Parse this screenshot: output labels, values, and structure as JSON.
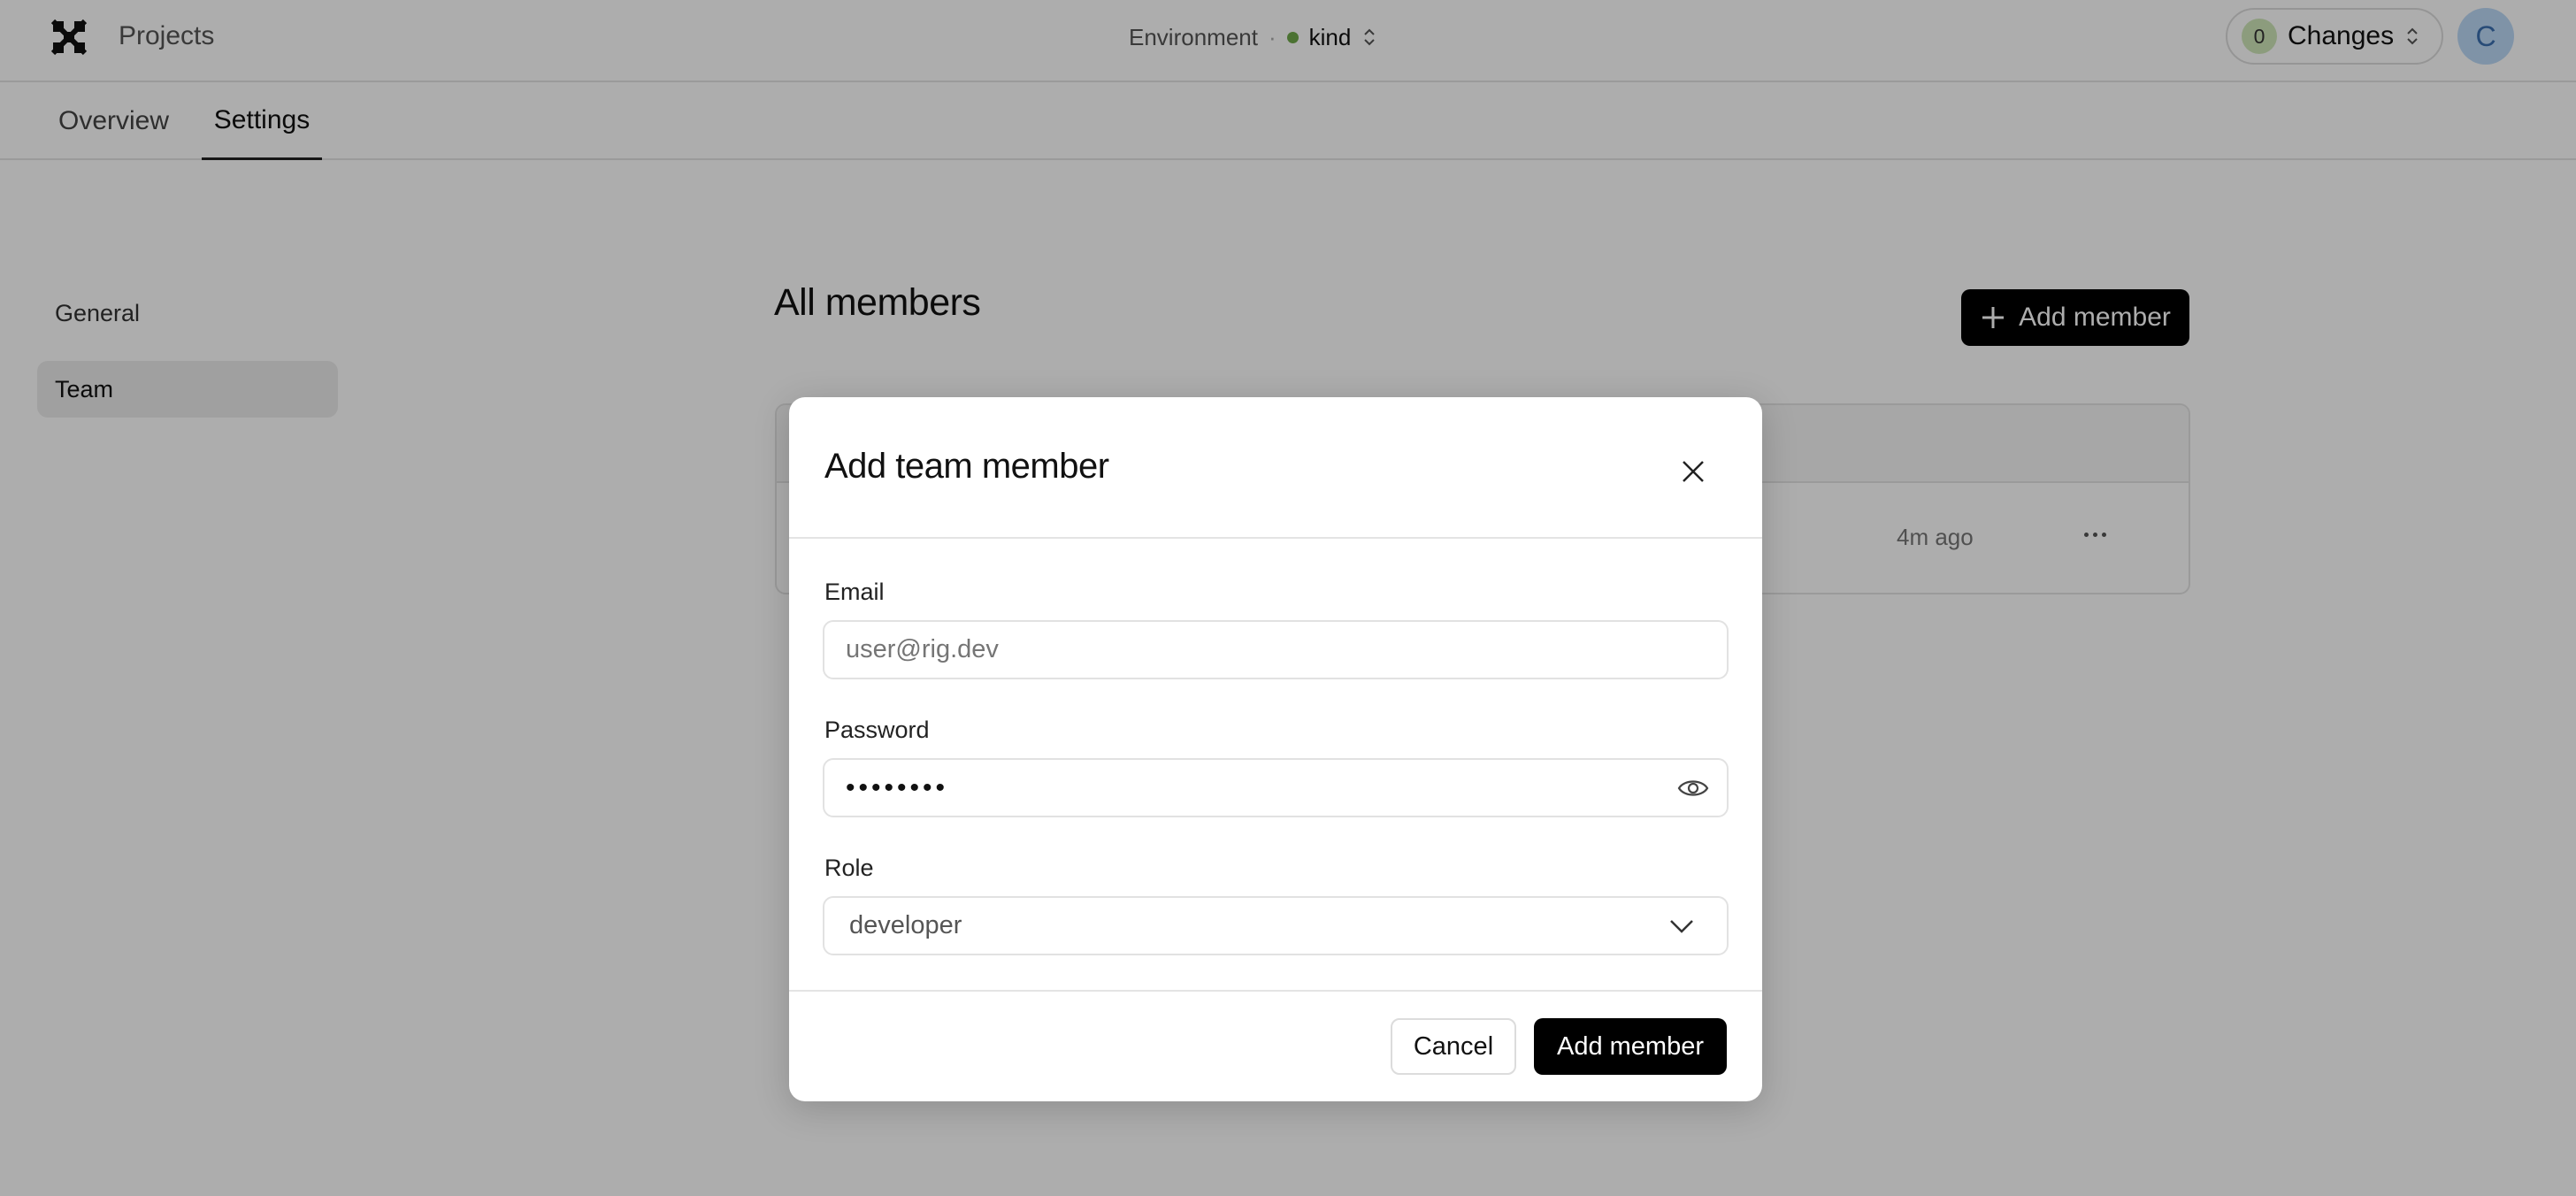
{
  "header": {
    "projects_label": "Projects",
    "environment": {
      "label": "Environment",
      "separator": "·",
      "name": "kind",
      "status_color": "#6fa84a"
    },
    "changes": {
      "count": "0",
      "label": "Changes",
      "badge_color": "#cfe6b8"
    },
    "avatar": {
      "initial": "C",
      "bg_color": "#bcd9f6",
      "text_color": "#3a6fb0"
    }
  },
  "tabs": [
    {
      "label": "Overview",
      "active": false
    },
    {
      "label": "Settings",
      "active": true
    }
  ],
  "settings_nav": [
    {
      "label": "General",
      "active": false
    },
    {
      "label": "Team",
      "active": true
    }
  ],
  "main": {
    "title": "All members",
    "add_member_label": "Add member",
    "rows": [
      {
        "time": "4m ago"
      }
    ]
  },
  "modal": {
    "title": "Add team member",
    "email": {
      "label": "Email",
      "placeholder": "user@rig.dev"
    },
    "password": {
      "label": "Password",
      "masked_value": "••••••••"
    },
    "role": {
      "label": "Role",
      "selected": "developer"
    },
    "cancel_label": "Cancel",
    "submit_label": "Add member"
  },
  "icons": {
    "logo": "rig-logo-icon",
    "env_chevron": "chevron-updown-icon",
    "changes_chevron": "chevron-updown-icon",
    "plus": "plus-icon",
    "row_menu": "more-horizontal-icon",
    "close": "close-icon",
    "eye": "eye-icon",
    "role_chevron": "chevron-down-icon"
  }
}
